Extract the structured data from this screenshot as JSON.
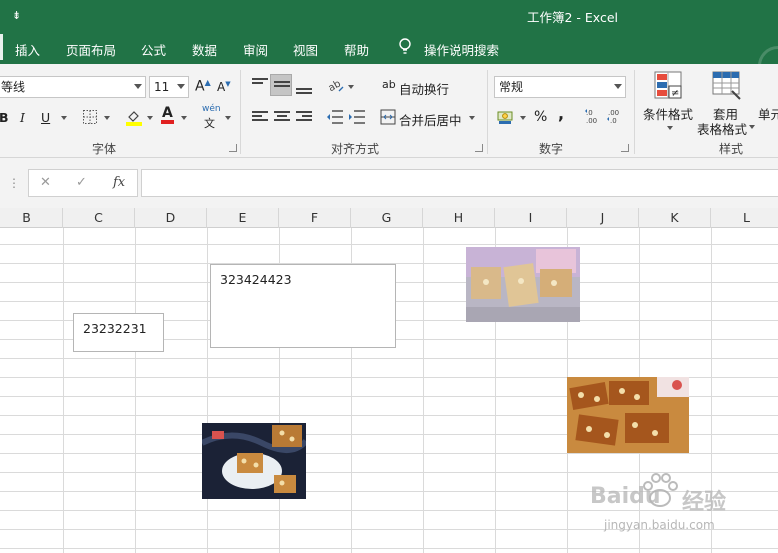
{
  "window": {
    "title": "工作簿2  -  Excel",
    "qat_glyph": "⇟"
  },
  "tabs": [
    "插入",
    "页面布局",
    "公式",
    "数据",
    "审阅",
    "视图",
    "帮助",
    "操作说明搜索"
  ],
  "ribbon": {
    "font": {
      "name": "等线",
      "size": "11",
      "grow": "A",
      "shrink": "A",
      "bold": "B",
      "italic": "I",
      "underline": "U",
      "font_color_letter": "A",
      "wen": "wén",
      "wen_char": "文",
      "label": "字体"
    },
    "alignment": {
      "wrap_text": "自动换行",
      "merge_center": "合并后居中",
      "label": "对齐方式",
      "ab_glyph": "ab"
    },
    "number": {
      "format": "常规",
      "percent": "%",
      "comma": ",",
      "inc_decimal": "←.0\n.00",
      "label": "数字"
    },
    "styles": {
      "conditional": "条件格式",
      "table_format_1": "套用",
      "table_format_2": "表格格式",
      "cell_styles": "单元",
      "label": "样式"
    }
  },
  "formula_bar": {
    "dots": "⋮",
    "cancel": "✕",
    "enter": "✓",
    "fx": "fx",
    "value": ""
  },
  "columns": [
    "B",
    "C",
    "D",
    "E",
    "F",
    "G",
    "H",
    "I",
    "J",
    "K",
    "L"
  ],
  "textboxes": [
    {
      "text": "23232231"
    },
    {
      "text": "323424423"
    }
  ],
  "watermark": {
    "brand": "Baidu",
    "brand_cn": "经验",
    "url": "jingyan.baidu.com"
  },
  "colors": {
    "excel_green": "#217346",
    "ribbon_bg": "#f3f3f3"
  }
}
